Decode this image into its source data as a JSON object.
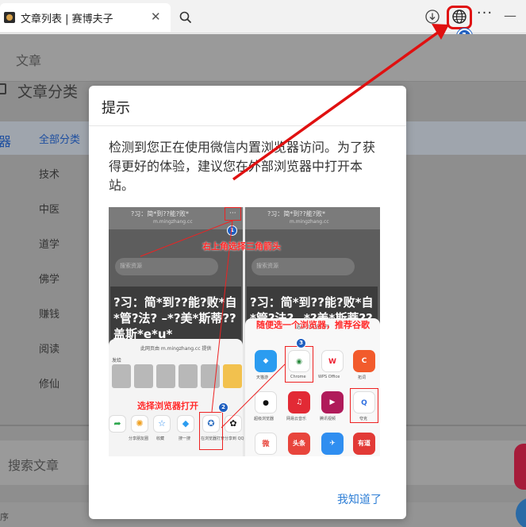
{
  "browser": {
    "tab_title": "文章列表 | 赛博夫子",
    "tab_close": "✕",
    "menu_glyph": "···",
    "minimize_glyph": "—",
    "step_badge": "1",
    "icons": [
      "favicon-icon",
      "close-icon",
      "search-icon",
      "download-icon",
      "globe-icon",
      "more-icon",
      "minimize-icon"
    ]
  },
  "page": {
    "header_title": "文章",
    "category_title": "文章分类",
    "sidebar_icon_glyph": "器",
    "categories": [
      "全部分类",
      "技术",
      "中医",
      "道学",
      "佛学",
      "赚钱",
      "阅读",
      "修仙"
    ],
    "search_label": "搜索文章",
    "bottom_label": "序"
  },
  "modal": {
    "title": "提示",
    "message": "检测到您正在使用微信内置浏览器访问。为了获得更好的体验，建议您在外部浏览器中打开本站。",
    "ok_label": "我知道了",
    "illustration": {
      "url_title": "?习：简*到??能?败*",
      "url_host": "m.mingzhang.cc",
      "search_placeholder": "搜索资源",
      "banner_text": "?习：简*到??能?败*自*管?法? –*?美*斯蒂??盖斯*e*u*",
      "sheet_left_title": "此网页由 m.mingzhang.cc 提供",
      "sheet_left_section": "发给",
      "sheet_left_actions": [
        "",
        "分享朋友圈",
        "收藏",
        "搜一搜",
        "在浏览器打开",
        "分享到 QQ"
      ],
      "sheet_right_title": "选择浏览器打开",
      "apps": [
        {
          "name": "天猫游",
          "glyph": "◆",
          "color": "#2b9cf0"
        },
        {
          "name": "Chrome",
          "glyph": "◉",
          "color": "#ffffff"
        },
        {
          "name": "WPS Office",
          "glyph": "W",
          "color": "#ffffff"
        },
        {
          "name": "拓词",
          "glyph": "C",
          "color": "#f25b2c"
        },
        {
          "name": "超级浏览器",
          "glyph": "●",
          "color": "#ffffff"
        },
        {
          "name": "网易云音乐",
          "glyph": "♫",
          "color": "#e22a35"
        },
        {
          "name": "腾讯视频",
          "glyph": "▶",
          "color": "#b01b5a"
        },
        {
          "name": "夸克",
          "glyph": "Q",
          "color": "#ffffff"
        },
        {
          "name": "",
          "glyph": "微",
          "color": "#ffffff"
        },
        {
          "name": "",
          "glyph": "头条",
          "color": "#e8453c"
        },
        {
          "name": "",
          "glyph": "✈",
          "color": "#2f8ef0"
        },
        {
          "name": "",
          "glyph": "有道",
          "color": "#e23a36"
        }
      ],
      "captions": {
        "step1": "右上角选择三角箭头",
        "step2": "选择浏览器打开",
        "step3": "随便选一个浏览器，推荐谷歌"
      },
      "badges": [
        "1",
        "2",
        "3"
      ]
    }
  },
  "colors": {
    "accent_red": "#e01010",
    "badge_blue": "#1f5fc0",
    "link_blue": "#2f7fd6"
  }
}
